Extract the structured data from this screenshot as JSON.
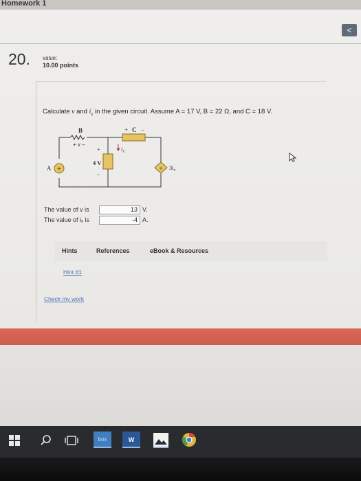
{
  "window": {
    "title": "Homework 1",
    "collapse_glyph": "<"
  },
  "question": {
    "number": "20.",
    "value_label": "value:",
    "points": "10.00 points",
    "prompt_parts": {
      "p1": "Calculate ",
      "v": "v",
      "p2": " and ",
      "ix": "i",
      "ix_sub": "x",
      "p3": " in the given circuit. Assume A = 17 V, B = 22 Ω, and C = 18 V."
    }
  },
  "circuit": {
    "label_B": "B",
    "label_C": "C",
    "label_A": "A",
    "label_plus_c": "+",
    "label_minus_c": "–",
    "label_v": "+ v –",
    "label_4v": "4 V",
    "label_ix": "i",
    "label_ix_sub": "x",
    "label_dep": "3i",
    "label_dep_sub": "x",
    "label_plus_4v": "+",
    "label_minus_4v": "–"
  },
  "answers": {
    "v_label": "The value of v is",
    "v_value": "13",
    "v_unit": "V.",
    "ix_label": "The value of iₓ is",
    "ix_value": "-4",
    "ix_unit": "A."
  },
  "tabs": [
    "Hints",
    "References",
    "eBook & Resources"
  ],
  "hint_link": "Hint #1",
  "check_link": "Check my work",
  "taskbar": {
    "icons": [
      "windows-start-icon",
      "search-icon",
      "task-view-icon",
      "box-app-icon",
      "word-icon",
      "photos-icon",
      "chrome-icon"
    ],
    "box_label": "box",
    "word_label": "W"
  },
  "colors": {
    "accent_bar": "#d2604f",
    "taskbar": "#2a2b2f",
    "link": "#4a70b0"
  }
}
